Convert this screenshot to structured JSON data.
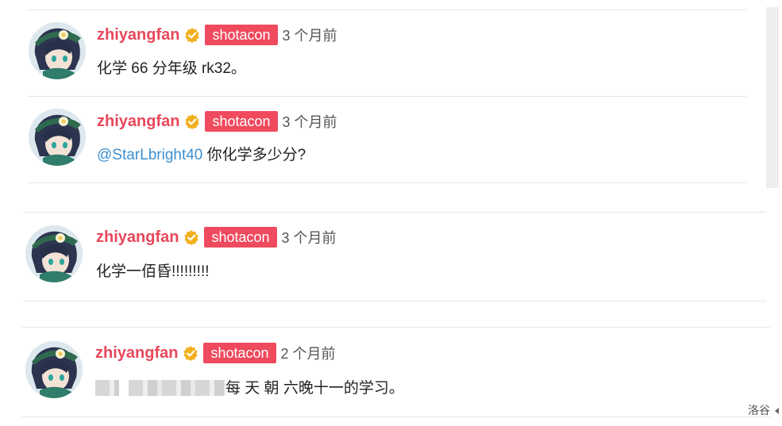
{
  "comments": [
    {
      "username": "zhiyangfan",
      "tag": "shotacon",
      "time": "3 个月前",
      "text": "化学 66 分年级 rk32。"
    },
    {
      "username": "zhiyangfan",
      "tag": "shotacon",
      "time": "3 个月前",
      "mention": "@StarLbright40",
      "text": " 你化学多少分?"
    },
    {
      "username": "zhiyangfan",
      "tag": "shotacon",
      "time": "3 个月前",
      "text": "化学一佰昏!!!!!!!!!"
    },
    {
      "username": "zhiyangfan",
      "tag": "shotacon",
      "time": "2 个月前",
      "text": "每 天 朝 六晚十一的学习。"
    }
  ],
  "footer": {
    "label": "洛谷"
  },
  "colors": {
    "username": "#e8475b",
    "tag_bg": "#ef4a5d",
    "mention": "#3c8fcf",
    "verified": "#f2b01e"
  },
  "icons": {
    "verified": "verified-check-icon",
    "collapse": "caret-left-icon"
  }
}
